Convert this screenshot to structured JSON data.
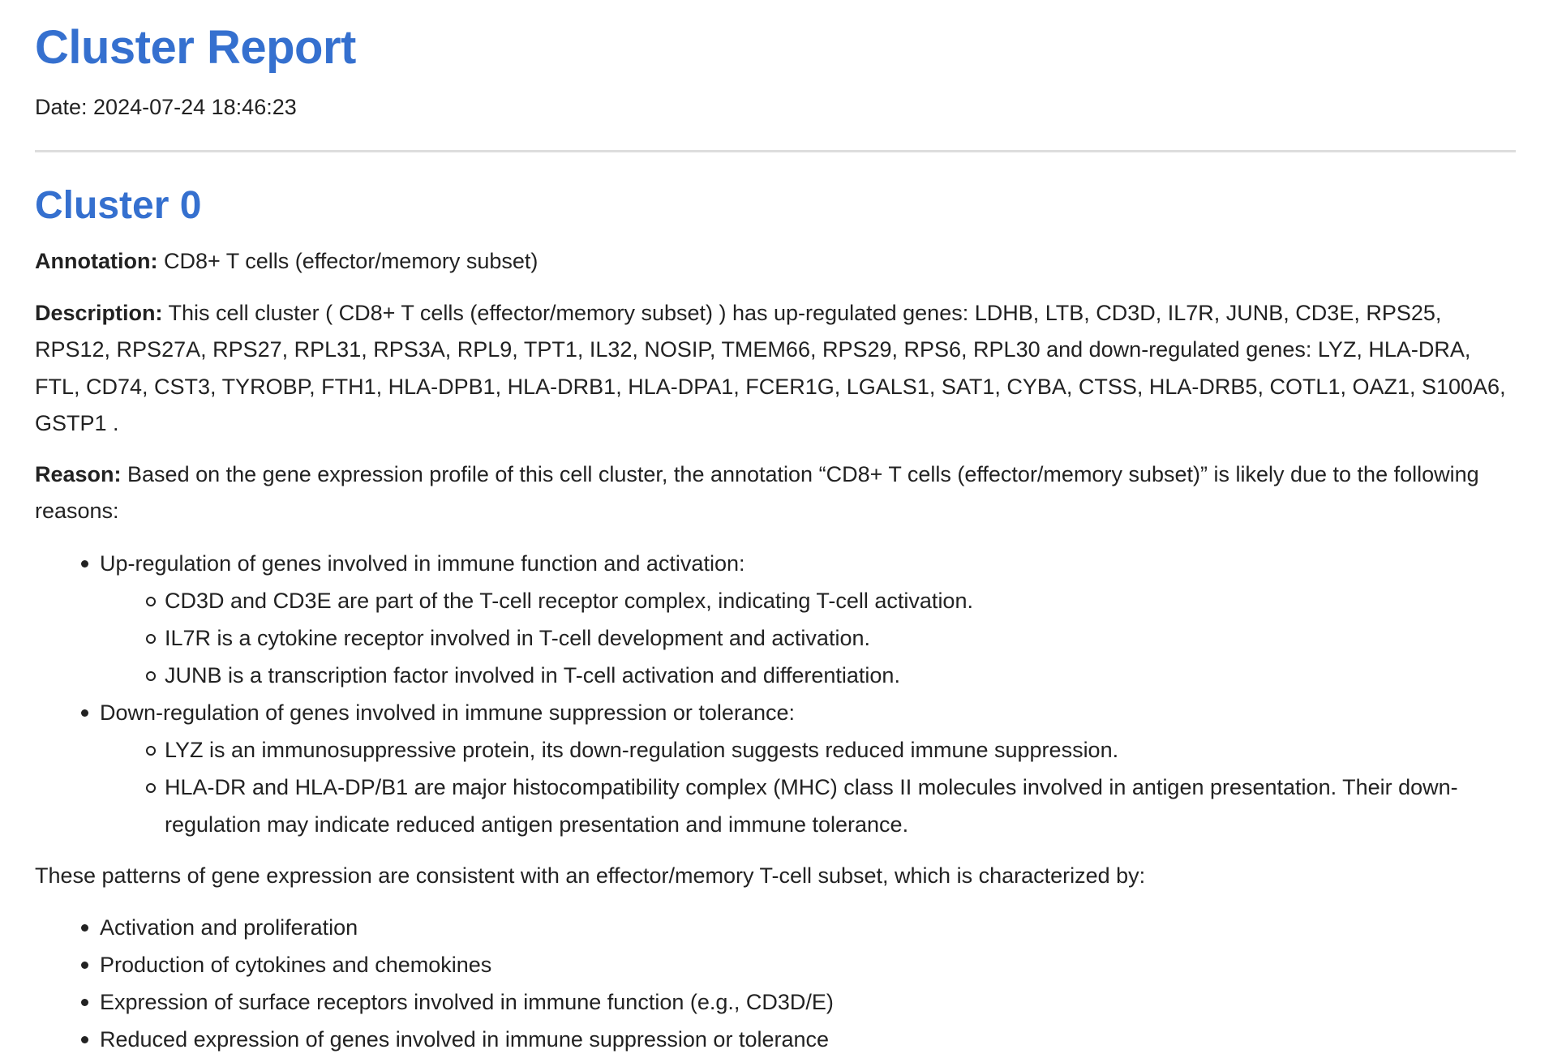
{
  "report": {
    "title": "Cluster Report",
    "date": "Date: 2024-07-24 18:46:23"
  },
  "cluster": {
    "title": "Cluster 0",
    "annotation_label": "Annotation:",
    "annotation_text": " CD8+ T cells (effector/memory subset)",
    "description_label": "Description:",
    "description_text": " This cell cluster ( CD8+ T cells (effector/memory subset) ) has up-regulated genes: LDHB, LTB, CD3D, IL7R, JUNB, CD3E, RPS25, RPS12, RPS27A, RPS27, RPL31, RPS3A, RPL9, TPT1, IL32, NOSIP, TMEM66, RPS29, RPS6, RPL30 and down-regulated genes: LYZ, HLA-DRA, FTL, CD74, CST3, TYROBP, FTH1, HLA-DPB1, HLA-DRB1, HLA-DPA1, FCER1G, LGALS1, SAT1, CYBA, CTSS, HLA-DRB5, COTL1, OAZ1, S100A6, GSTP1 .",
    "reason_label": "Reason:",
    "reason_text": " Based on the gene expression profile of this cell cluster, the annotation “CD8+ T cells (effector/memory subset)” is likely due to the following reasons:",
    "reasons": [
      {
        "text": "Up-regulation of genes involved in immune function and activation:",
        "subitems": [
          "CD3D and CD3E are part of the T-cell receptor complex, indicating T-cell activation.",
          "IL7R is a cytokine receptor involved in T-cell development and activation.",
          "JUNB is a transcription factor involved in T-cell activation and differentiation."
        ]
      },
      {
        "text": "Down-regulation of genes involved in immune suppression or tolerance:",
        "subitems": [
          "LYZ is an immunosuppressive protein, its down-regulation suggests reduced immune suppression.",
          "HLA-DR and HLA-DP/B1 are major histocompatibility complex (MHC) class II molecules involved in antigen presentation. Their down-regulation may indicate reduced antigen presentation and immune tolerance."
        ]
      }
    ],
    "summary_text": "These patterns of gene expression are consistent with an effector/memory T-cell subset, which is characterized by:",
    "features": [
      "Activation and proliferation",
      "Production of cytokines and chemokines",
      "Expression of surface receptors involved in immune function (e.g., CD3D/E)",
      "Reduced expression of genes involved in immune suppression or tolerance"
    ]
  },
  "colors": {
    "heading": "#3570cf",
    "text": "#222222",
    "divider": "#dddddd"
  }
}
